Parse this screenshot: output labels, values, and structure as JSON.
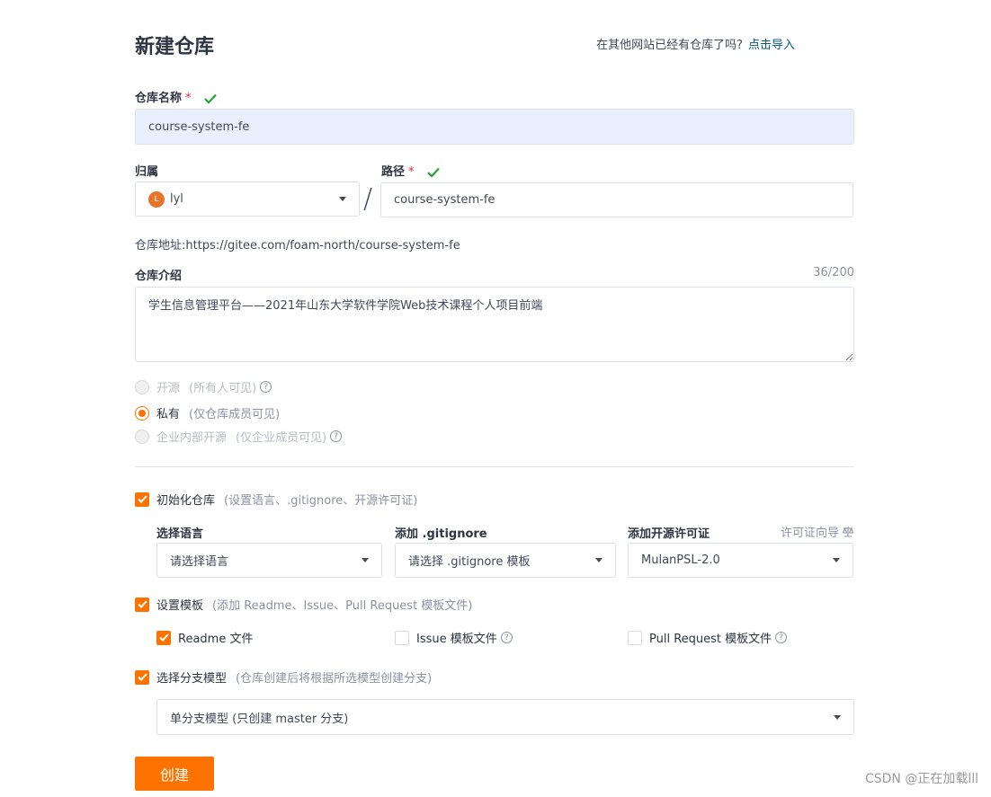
{
  "page": {
    "title": "新建仓库",
    "import_question": "在其他网站已经有仓库了吗?",
    "import_link": "点击导入"
  },
  "repo_name": {
    "label": "仓库名称",
    "required": "*",
    "value": "course-system-fe"
  },
  "owner": {
    "label": "归属",
    "avatar_letter": "L",
    "value": "lyl"
  },
  "path": {
    "label": "路径",
    "required": "*",
    "separator": "/",
    "value": "course-system-fe"
  },
  "repo_url": {
    "label": "仓库地址:",
    "value": "https://gitee.com/foam-north/course-system-fe"
  },
  "intro": {
    "label": "仓库介绍",
    "counter": "36/200",
    "value": "学生信息管理平台——2021年山东大学软件学院Web技术课程个人项目前端"
  },
  "visibility": [
    {
      "label": "开源",
      "hint": "(所有人可见)",
      "selected": false,
      "disabled": true,
      "help": true
    },
    {
      "label": "私有",
      "hint": "(仅仓库成员可见)",
      "selected": true,
      "disabled": false,
      "help": false
    },
    {
      "label": "企业内部开源",
      "hint": "(仅企业成员可见)",
      "selected": false,
      "disabled": true,
      "help": true
    }
  ],
  "init_repo": {
    "label": "初始化仓库",
    "hint": "(设置语言、.gitignore、开源许可证)",
    "checked": true,
    "language": {
      "label": "选择语言",
      "value": "请选择语言"
    },
    "gitignore": {
      "label": "添加 .gitignore",
      "value": "请选择 .gitignore 模板"
    },
    "license": {
      "label": "添加开源许可证",
      "guide": "许可证向导",
      "guide_icon": "scale-icon",
      "value": "MulanPSL-2.0"
    }
  },
  "templates": {
    "label": "设置模板",
    "hint": "(添加 Readme、Issue、Pull Request 模板文件)",
    "checked": true,
    "items": [
      {
        "label": "Readme 文件",
        "checked": true,
        "help": false
      },
      {
        "label": "Issue 模板文件",
        "checked": false,
        "help": true
      },
      {
        "label": "Pull Request 模板文件",
        "checked": false,
        "help": true
      }
    ]
  },
  "branch_model": {
    "label": "选择分支模型",
    "hint": "(仓库创建后将根据所选模型创建分支)",
    "checked": true,
    "value": "单分支模型 (只创建 master 分支)"
  },
  "actions": {
    "create": "创建"
  },
  "watermark": "CSDN @正在加载lll",
  "colors": {
    "accent": "#fe7300",
    "link": "#005980",
    "success": "#21a336",
    "required": "#f5222d"
  }
}
